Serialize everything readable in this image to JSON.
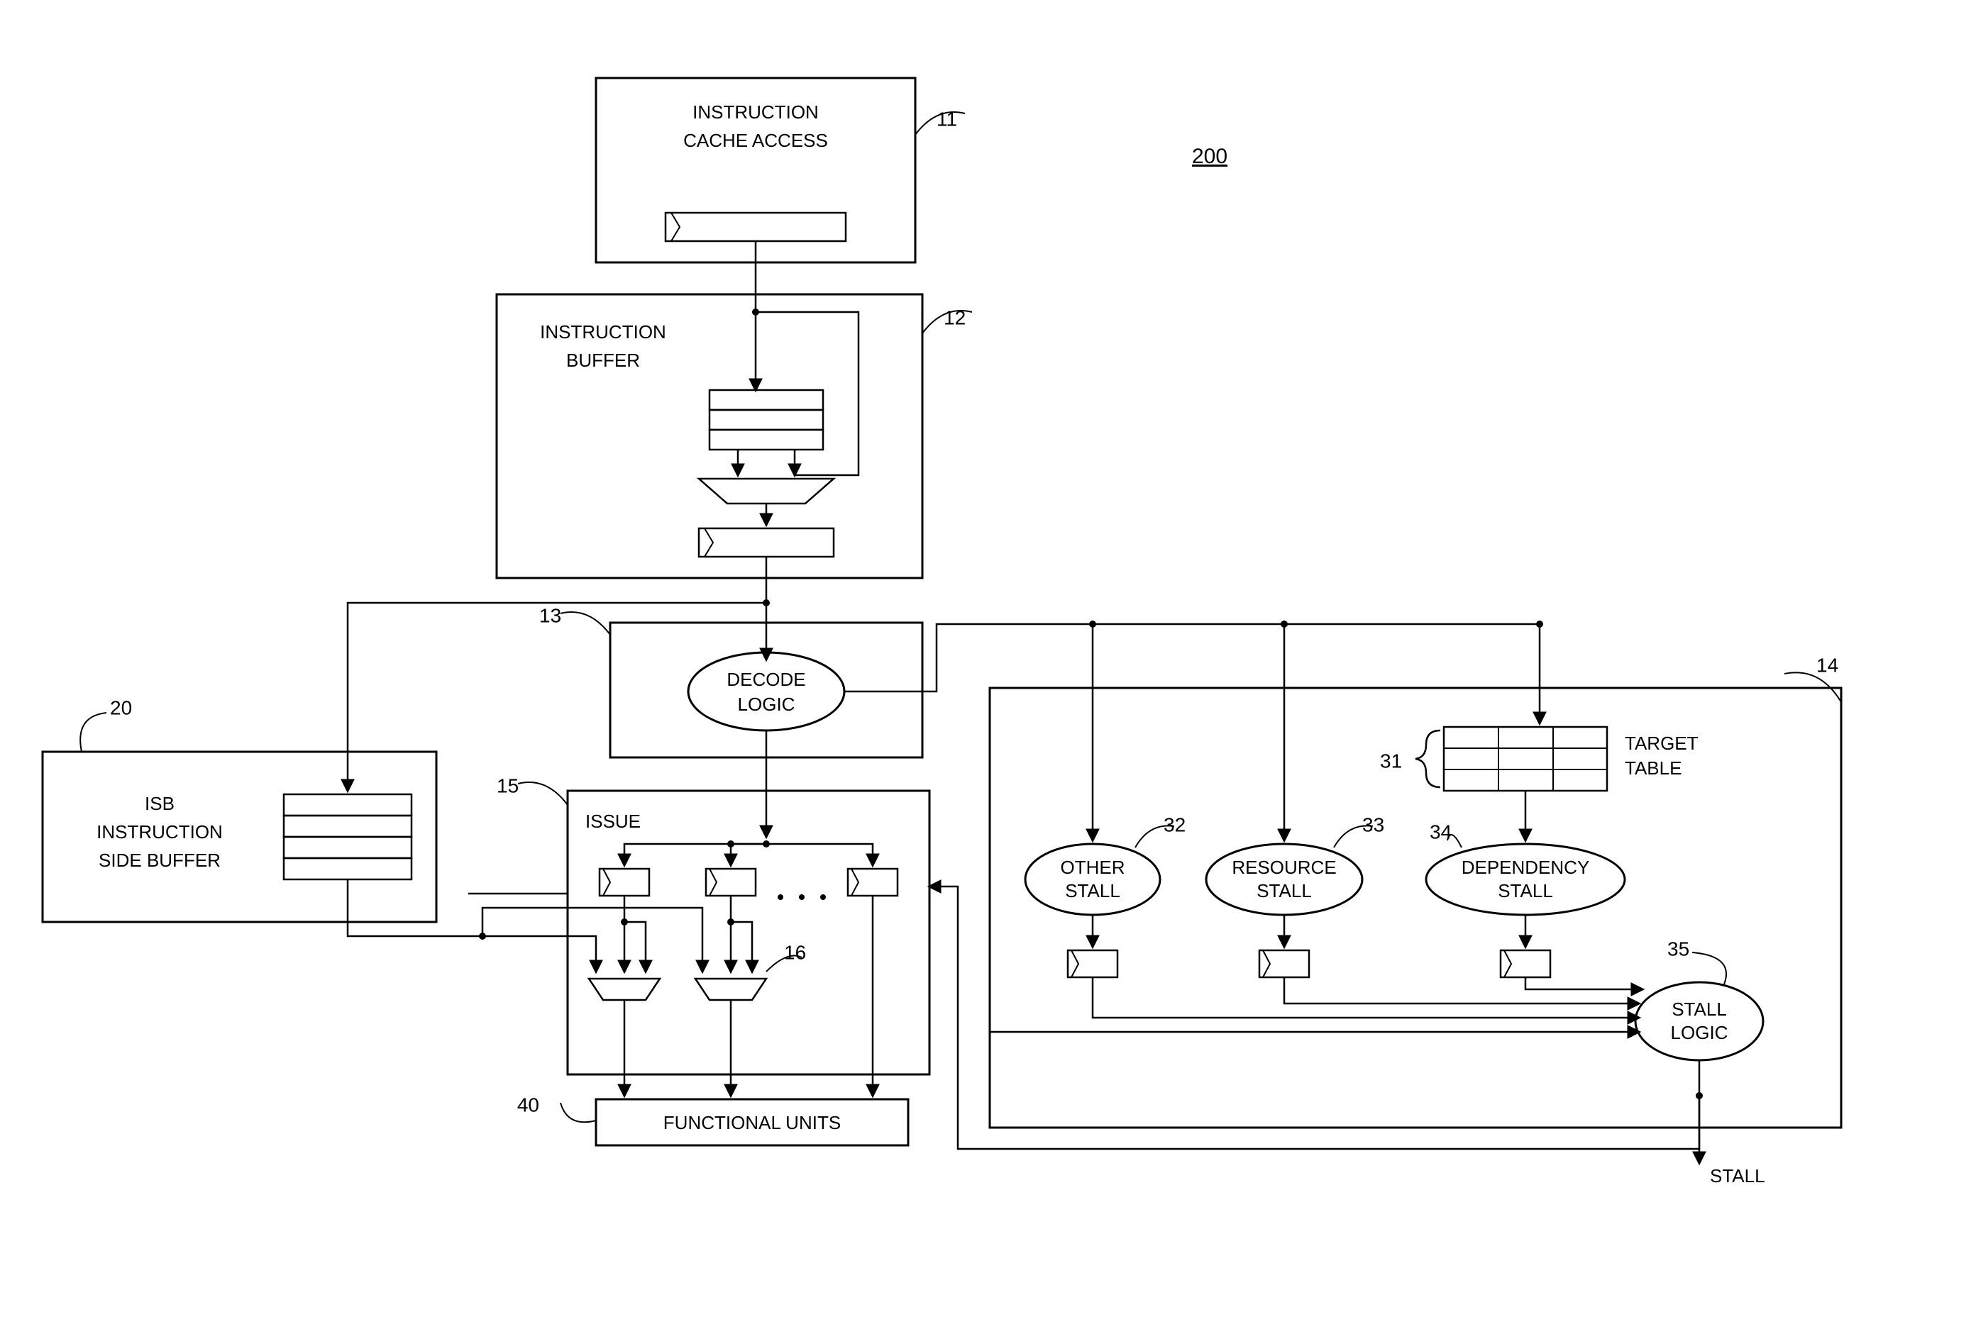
{
  "figure_number": "200",
  "blocks": {
    "instruction_cache_access": {
      "ref": "11",
      "label1": "INSTRUCTION",
      "label2": "CACHE ACCESS"
    },
    "instruction_buffer": {
      "ref": "12",
      "label1": "INSTRUCTION",
      "label2": "BUFFER"
    },
    "decode_logic": {
      "ref": "13",
      "label1": "DECODE",
      "label2": "LOGIC"
    },
    "stall_block": {
      "ref": "14"
    },
    "issue": {
      "ref": "15",
      "label": "ISSUE",
      "mux_ref": "16"
    },
    "isb": {
      "ref": "20",
      "label1": "ISB",
      "label2": "INSTRUCTION",
      "label3": "SIDE BUFFER"
    },
    "target_table": {
      "ref": "31",
      "label1": "TARGET",
      "label2": "TABLE"
    },
    "other_stall": {
      "ref": "32",
      "label1": "OTHER",
      "label2": "STALL"
    },
    "resource_stall": {
      "ref": "33",
      "label1": "RESOURCE",
      "label2": "STALL"
    },
    "dependency_stall": {
      "ref": "34",
      "label1": "DEPENDENCY",
      "label2": "STALL"
    },
    "stall_logic": {
      "ref": "35",
      "label1": "STALL",
      "label2": "LOGIC"
    },
    "functional_units": {
      "ref": "40",
      "label": "FUNCTIONAL  UNITS"
    }
  },
  "output_label": "STALL"
}
